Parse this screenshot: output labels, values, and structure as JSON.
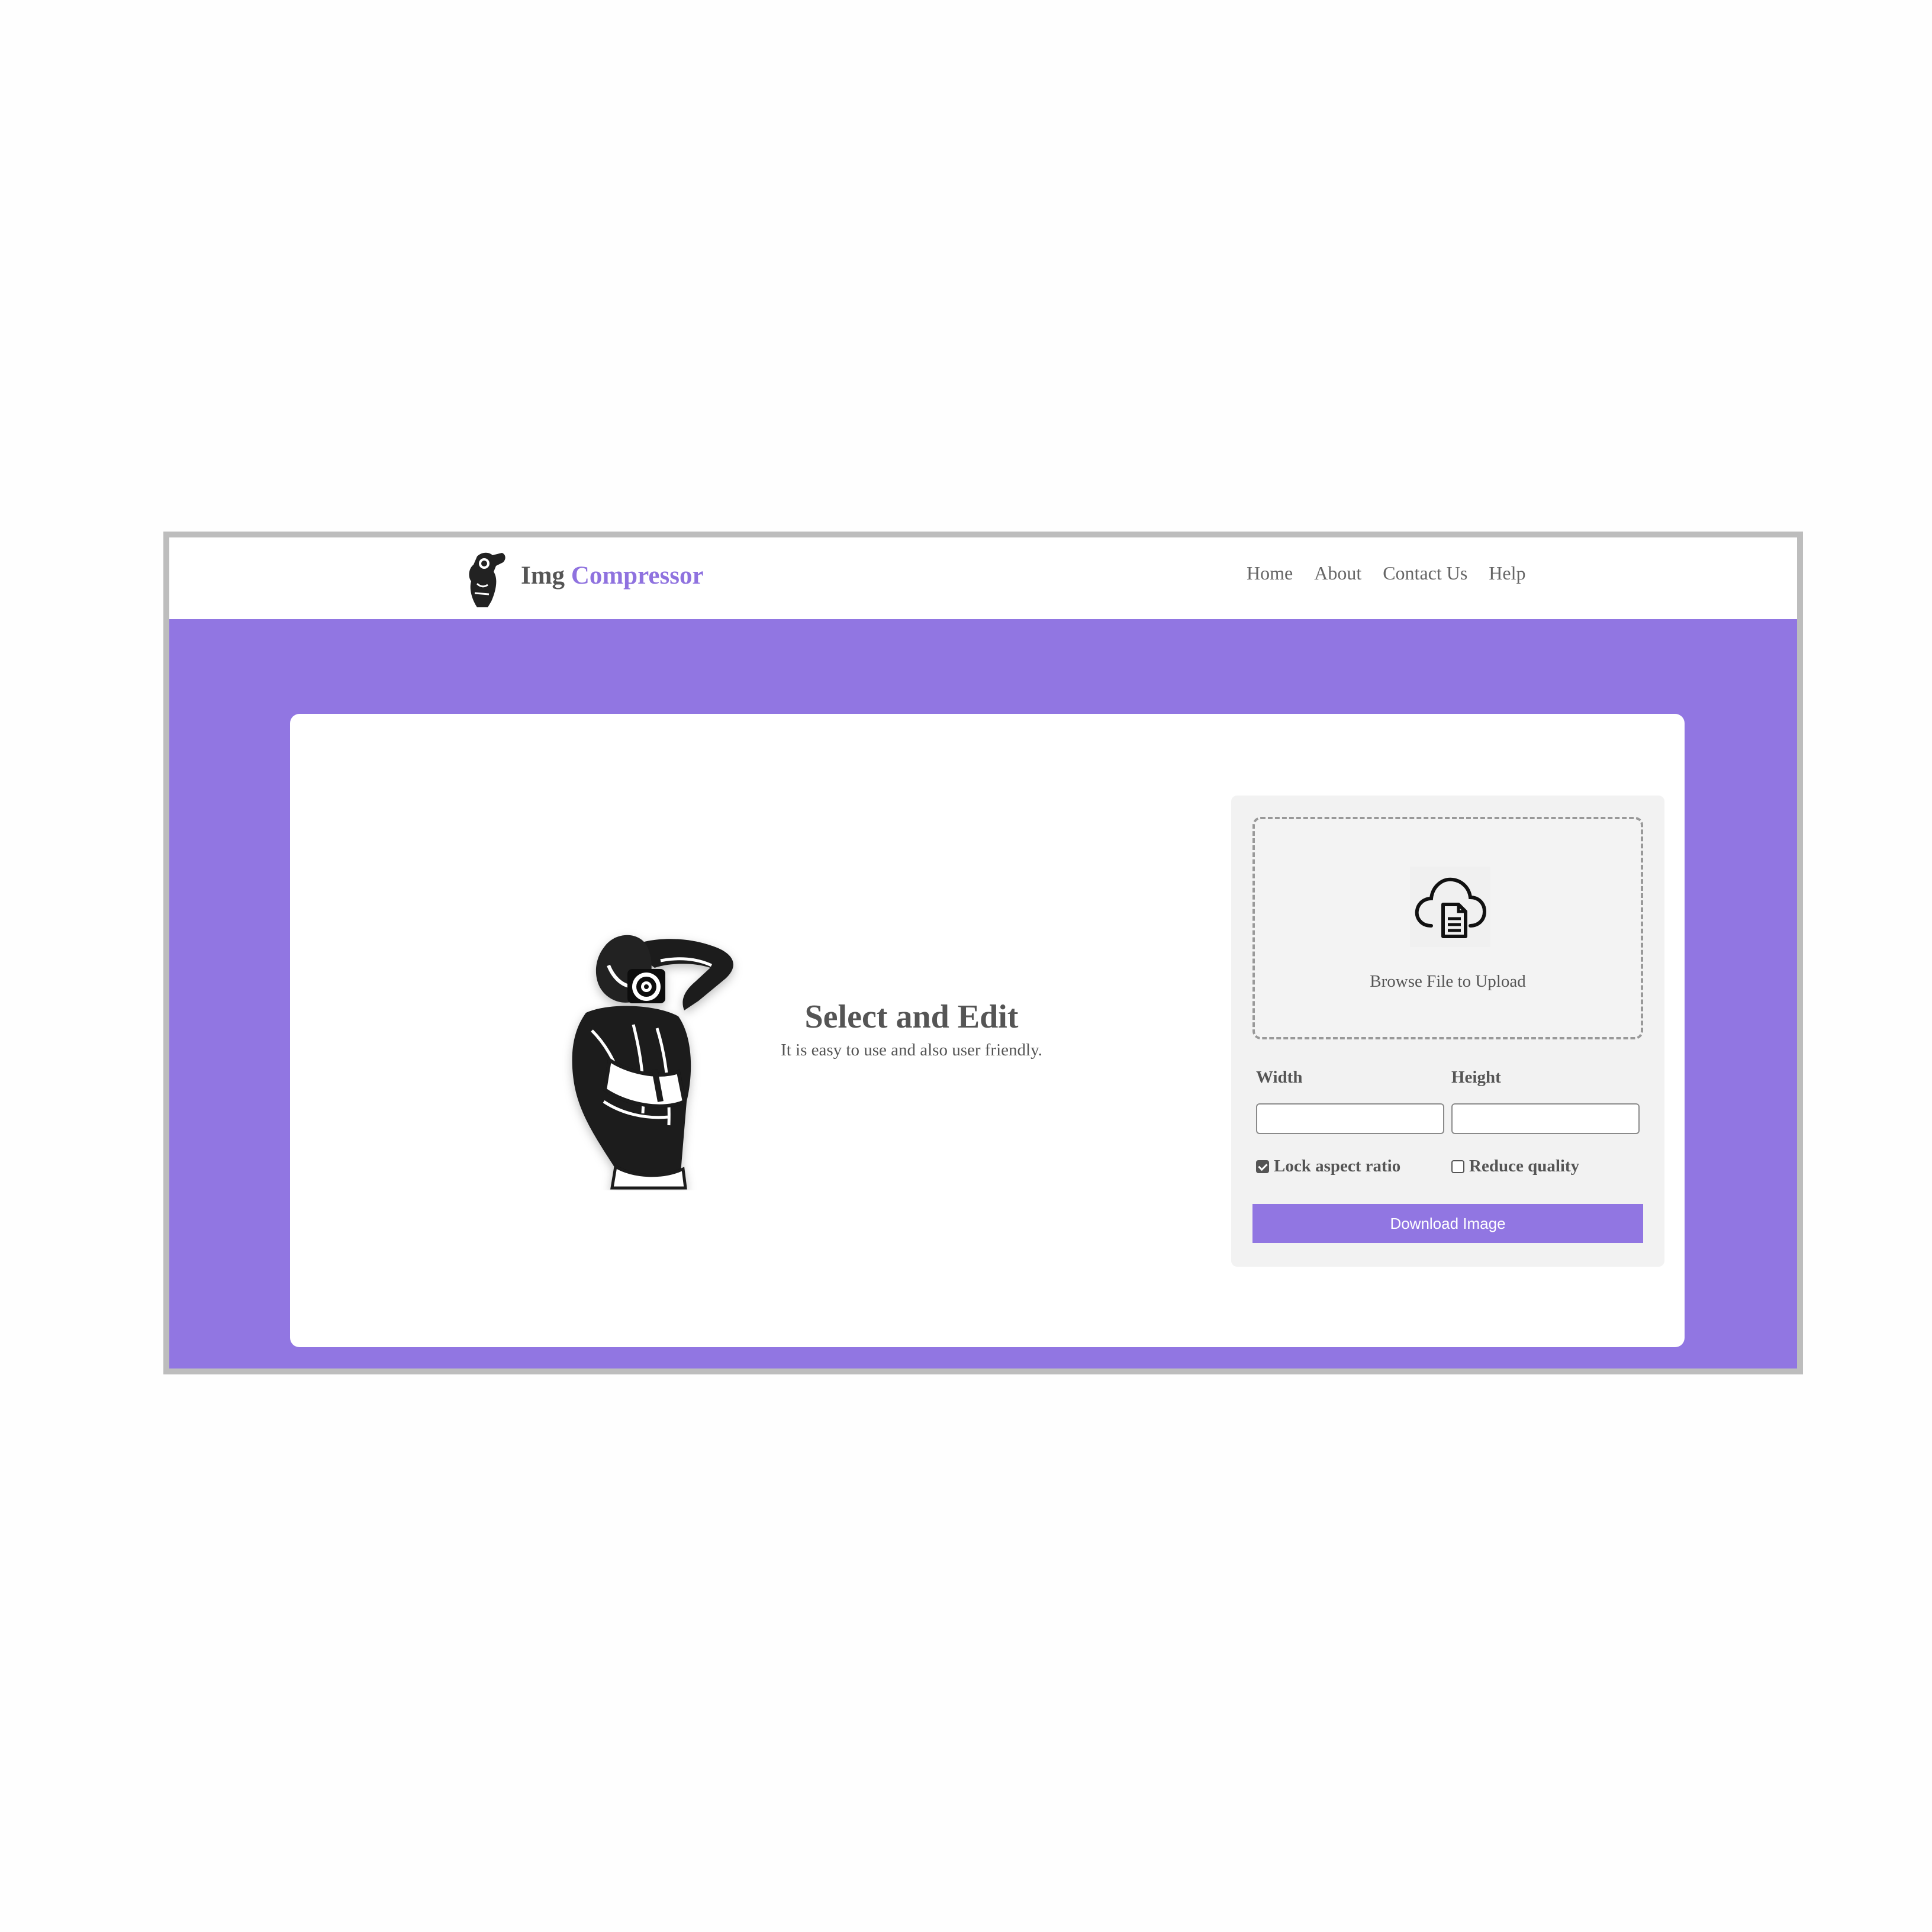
{
  "brand": {
    "name_part1": "Img",
    "name_part2": "Compressor",
    "logo": "photographer-logo-icon"
  },
  "nav": {
    "items": [
      {
        "label": "Home"
      },
      {
        "label": "About"
      },
      {
        "label": "Contact Us"
      },
      {
        "label": "Help"
      }
    ]
  },
  "hero": {
    "image": "photographer-illustration",
    "title": "Select and Edit",
    "subtitle": "It is easy to use and also user friendly."
  },
  "upload": {
    "icon": "cloud-upload-document-icon",
    "label": "Browse File to Upload"
  },
  "dimensions": {
    "width_label": "Width",
    "width_value": "",
    "height_label": "Height",
    "height_value": ""
  },
  "options": {
    "lock_aspect_label": "Lock aspect ratio",
    "lock_aspect_checked": true,
    "reduce_quality_label": "Reduce quality",
    "reduce_quality_checked": false
  },
  "actions": {
    "download_label": "Download Image"
  },
  "colors": {
    "accent": "#9176e2",
    "text": "#555555",
    "panel": "#f2f2f2",
    "frame_border": "#bdbdbd"
  }
}
